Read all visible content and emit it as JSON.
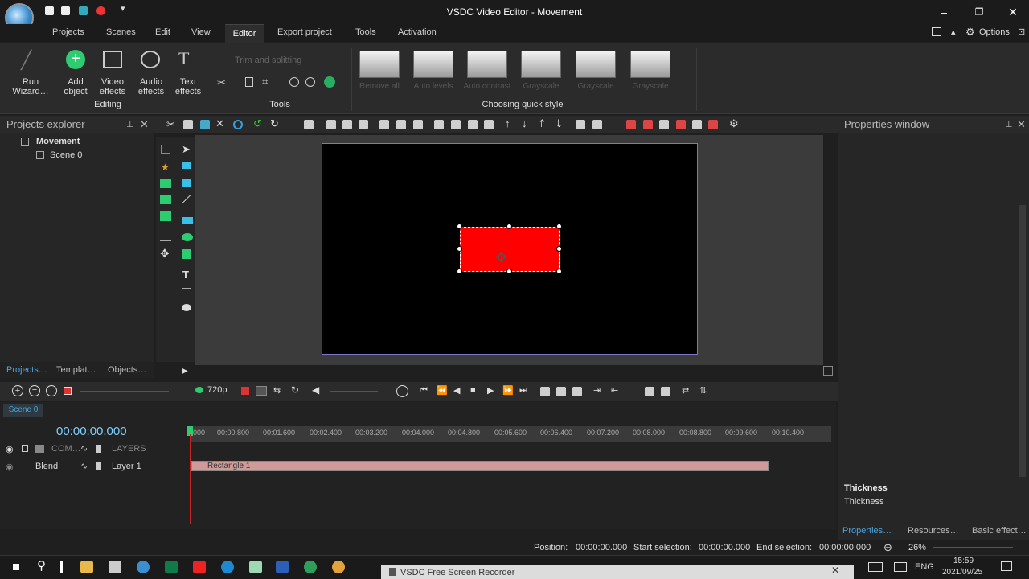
{
  "window": {
    "title": "VSDC Video Editor - Movement",
    "minimize_label": "–",
    "restore_label": "❐",
    "close_label": "✕"
  },
  "menu": {
    "items": [
      "Projects",
      "Scenes",
      "Edit",
      "View",
      "Editor",
      "Export project",
      "Tools",
      "Activation"
    ],
    "options_label": "Options"
  },
  "ribbon": {
    "run_wizard": "Run\nWizard…",
    "add_object": "Add\nobject",
    "video_effects": "Video\neffects",
    "audio_effects": "Audio\neffects",
    "text_effects": "Text\neffects",
    "editing_group": "Editing",
    "tools_group": "Tools",
    "trim_label": "Trim and splitting",
    "quick_style_group": "Choosing quick style",
    "quick_styles": [
      "Remove all",
      "Auto levels",
      "Auto contrast",
      "Grayscale",
      "Grayscale",
      "Grayscale"
    ]
  },
  "projects_explorer": {
    "title": "Projects explorer",
    "project": "Movement",
    "scene": "Scene 0",
    "tabs": [
      "Projects…",
      "Templat…",
      "Objects…"
    ]
  },
  "properties": {
    "title": "Properties window",
    "thickness_heading": "Thickness",
    "thickness_desc": "Thickness",
    "tabs": [
      "Properties…",
      "Resources…",
      "Basic effect…"
    ]
  },
  "transport": {
    "resolution": "720p"
  },
  "timeline": {
    "scene_tab": "Scene 0",
    "time": "00:00:00.000",
    "com_label": "COM…",
    "layers_label": "LAYERS",
    "blend": "Blend",
    "layer": "Layer 1",
    "clip": "Rectangle 1",
    "ruler": [
      "000",
      "00:00.800",
      "00:01.600",
      "00:02.400",
      "00:03.200",
      "00:04.000",
      "00:04.800",
      "00:05.600",
      "00:06.400",
      "00:07.200",
      "00:08.000",
      "00:08.800",
      "00:09.600",
      "00:10.400"
    ]
  },
  "status": {
    "position_label": "Position:",
    "position": "00:00:00.000",
    "start_label": "Start selection:",
    "start": "00:00:00.000",
    "end_label": "End selection:",
    "end": "00:00:00.000",
    "zoom": "26%"
  },
  "taskbar": {
    "recorder": "VSDC Free Screen Recorder",
    "lang": "ENG",
    "time": "15:59",
    "date": "2021/09/25"
  }
}
